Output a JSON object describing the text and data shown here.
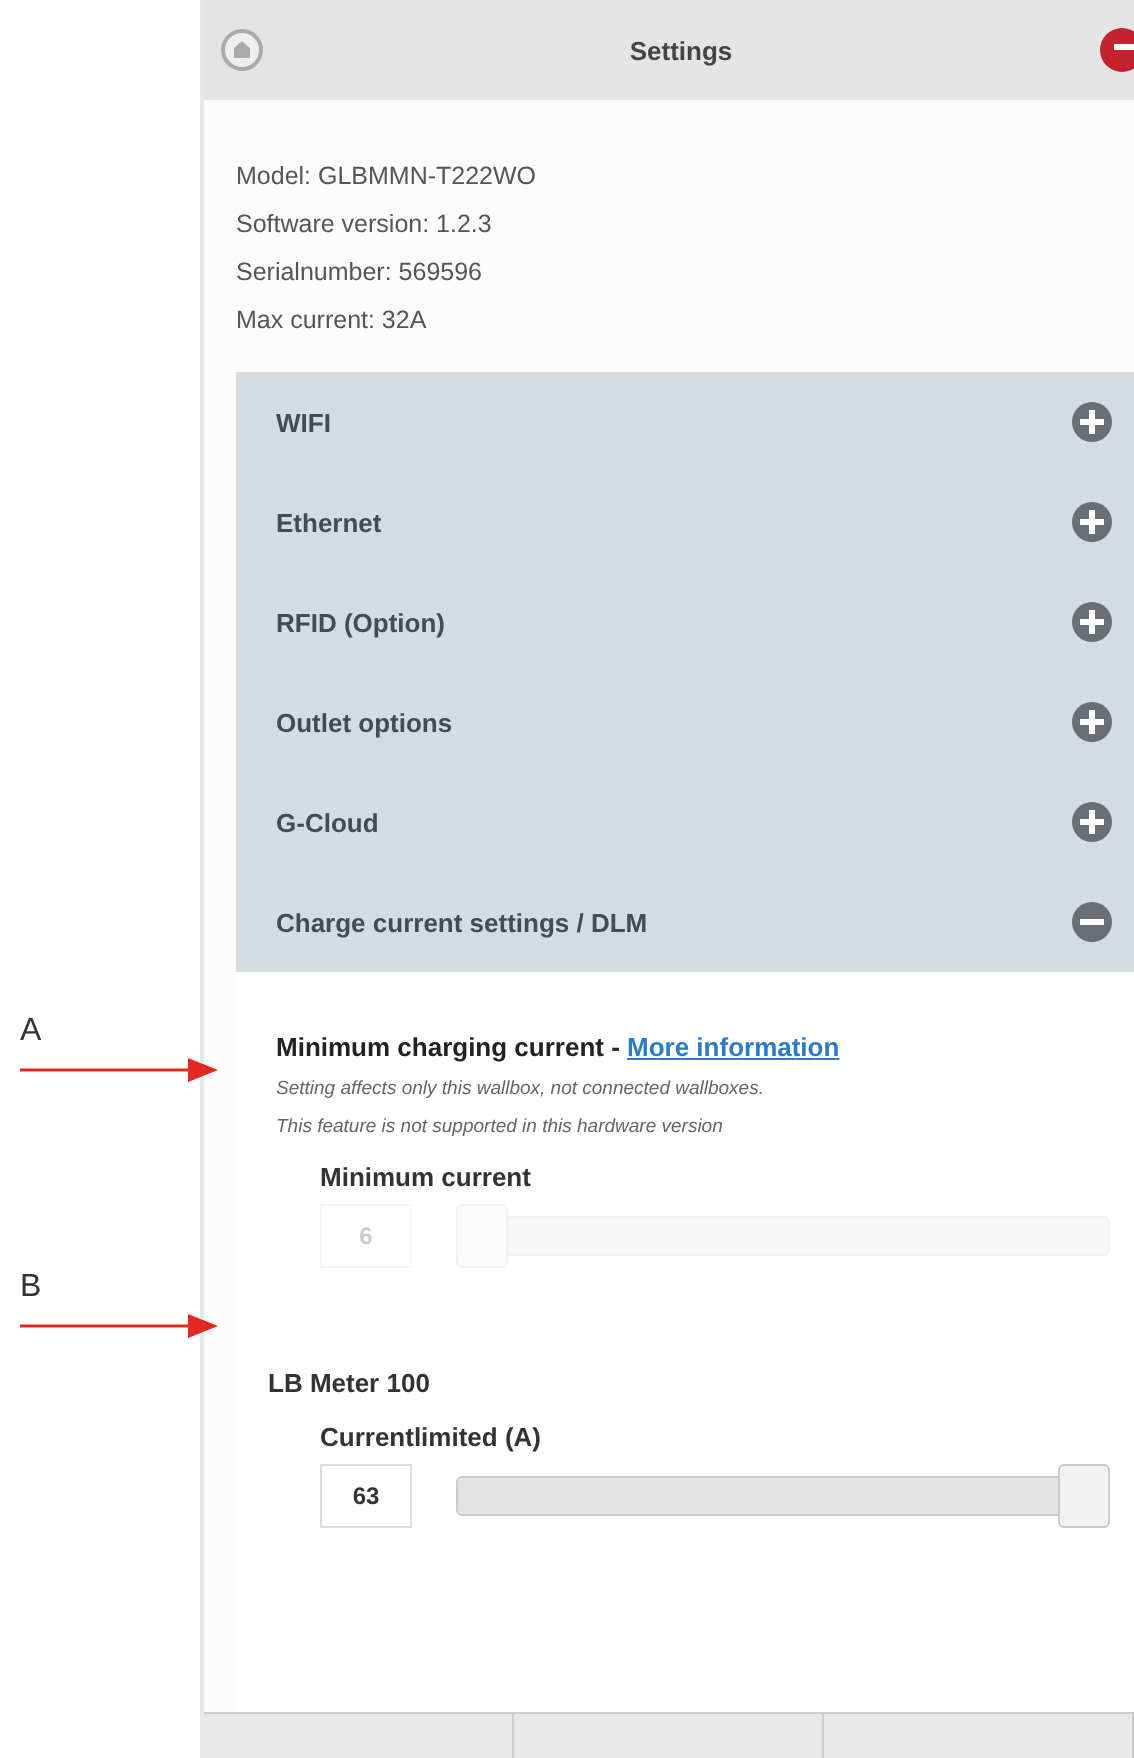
{
  "annotations": [
    {
      "label": "A"
    },
    {
      "label": "B"
    }
  ],
  "header": {
    "title": "Settings"
  },
  "info": [
    "Model: GLBMMN-T222WO",
    "Software version: 1.2.3",
    "Serialnumber: 569596",
    "Max current: 32A"
  ],
  "sections": [
    {
      "title": "WIFI",
      "expanded": false
    },
    {
      "title": "Ethernet",
      "expanded": false
    },
    {
      "title": "RFID (Option)",
      "expanded": false
    },
    {
      "title": "Outlet options",
      "expanded": false
    },
    {
      "title": "G-Cloud",
      "expanded": false
    },
    {
      "title": "Charge current settings / DLM",
      "expanded": true
    }
  ],
  "min_charging": {
    "title": "Minimum charging current - ",
    "link": "More information",
    "notes": [
      "Setting affects only this wallbox, not connected wallboxes.",
      "This feature is not supported in this hardware version"
    ],
    "slider": {
      "label": "Minimum current",
      "value": "6",
      "level": 0,
      "disabled": true
    }
  },
  "meter": {
    "title": "LB Meter 100",
    "slider": {
      "label": "Currentlimited (A)",
      "value": "63",
      "level": 1,
      "disabled": false
    }
  }
}
